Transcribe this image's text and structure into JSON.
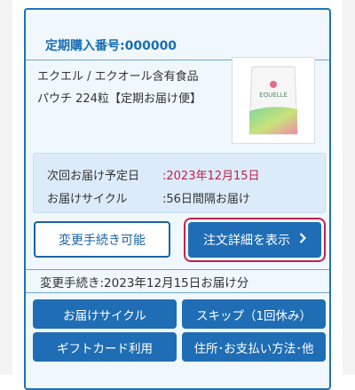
{
  "order": {
    "number_label": "定期購入番号:000000",
    "product_name_line1": "エクエル / エクオール含有食品",
    "product_name_line2": "パウチ 224粒【定期お届け便】",
    "product_image_text": "EQUELLE"
  },
  "delivery": {
    "next_date_label": "次回お届け予定日",
    "next_date_value": ":2023年12月15日",
    "cycle_label": "お届けサイクル",
    "cycle_value": ":56日間隔お届け"
  },
  "buttons": {
    "change_possible": "変更手続き可能",
    "order_detail": "注文詳細を表示"
  },
  "change_section": {
    "title": "変更手続き:2023年12月15日お届け分",
    "actions": [
      "お届けサイクル",
      "スキップ（1回休み）",
      "ギフトカード利用",
      "住所･お支払い方法･他"
    ]
  },
  "colors": {
    "accent_blue": "#1f6db4",
    "date_red": "#c0214a",
    "highlight_border": "#c1224f"
  }
}
